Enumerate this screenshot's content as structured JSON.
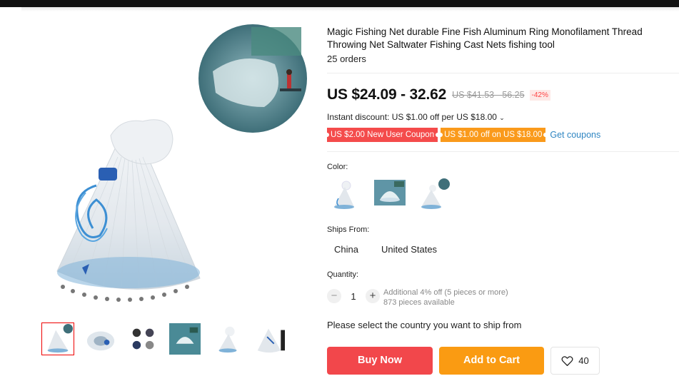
{
  "product": {
    "title": "Magic Fishing Net durable Fine Fish Aluminum Ring Monofilament Thread Throwing Net Saltwater Fishing Cast Nets fishing tool",
    "orders": "25 orders"
  },
  "price": {
    "current": "US $24.09 - 32.62",
    "original": "US $41.53 - 56.25",
    "discount": "-42%"
  },
  "instant_discount": "Instant discount: US $1.00 off per US $18.00",
  "coupons": {
    "new_user": "US $2.00 New User Coupon",
    "store": "US $1.00 off on US $18.00",
    "get_label": "Get coupons"
  },
  "color": {
    "label": "Color:"
  },
  "ships_from": {
    "label": "Ships From:",
    "options": [
      "China",
      "United States"
    ]
  },
  "quantity": {
    "label": "Quantity:",
    "value": "1",
    "minus": "−",
    "plus": "+",
    "bulk_note": "Additional 4% off (5 pieces or more)",
    "available": "873 pieces available"
  },
  "ship_message": "Please select the country you want to ship from",
  "actions": {
    "buy_now": "Buy Now",
    "add_to_cart": "Add to Cart",
    "wishlist_count": "40"
  },
  "icons": [
    "heart-icon",
    "chevron-down-icon"
  ],
  "colors": {
    "buy_now": "#f2474b",
    "add_to_cart": "#fa9b12",
    "coupon_red": "#f44b4b",
    "coupon_orange": "#fa9a1b",
    "link": "#2f86c2"
  }
}
